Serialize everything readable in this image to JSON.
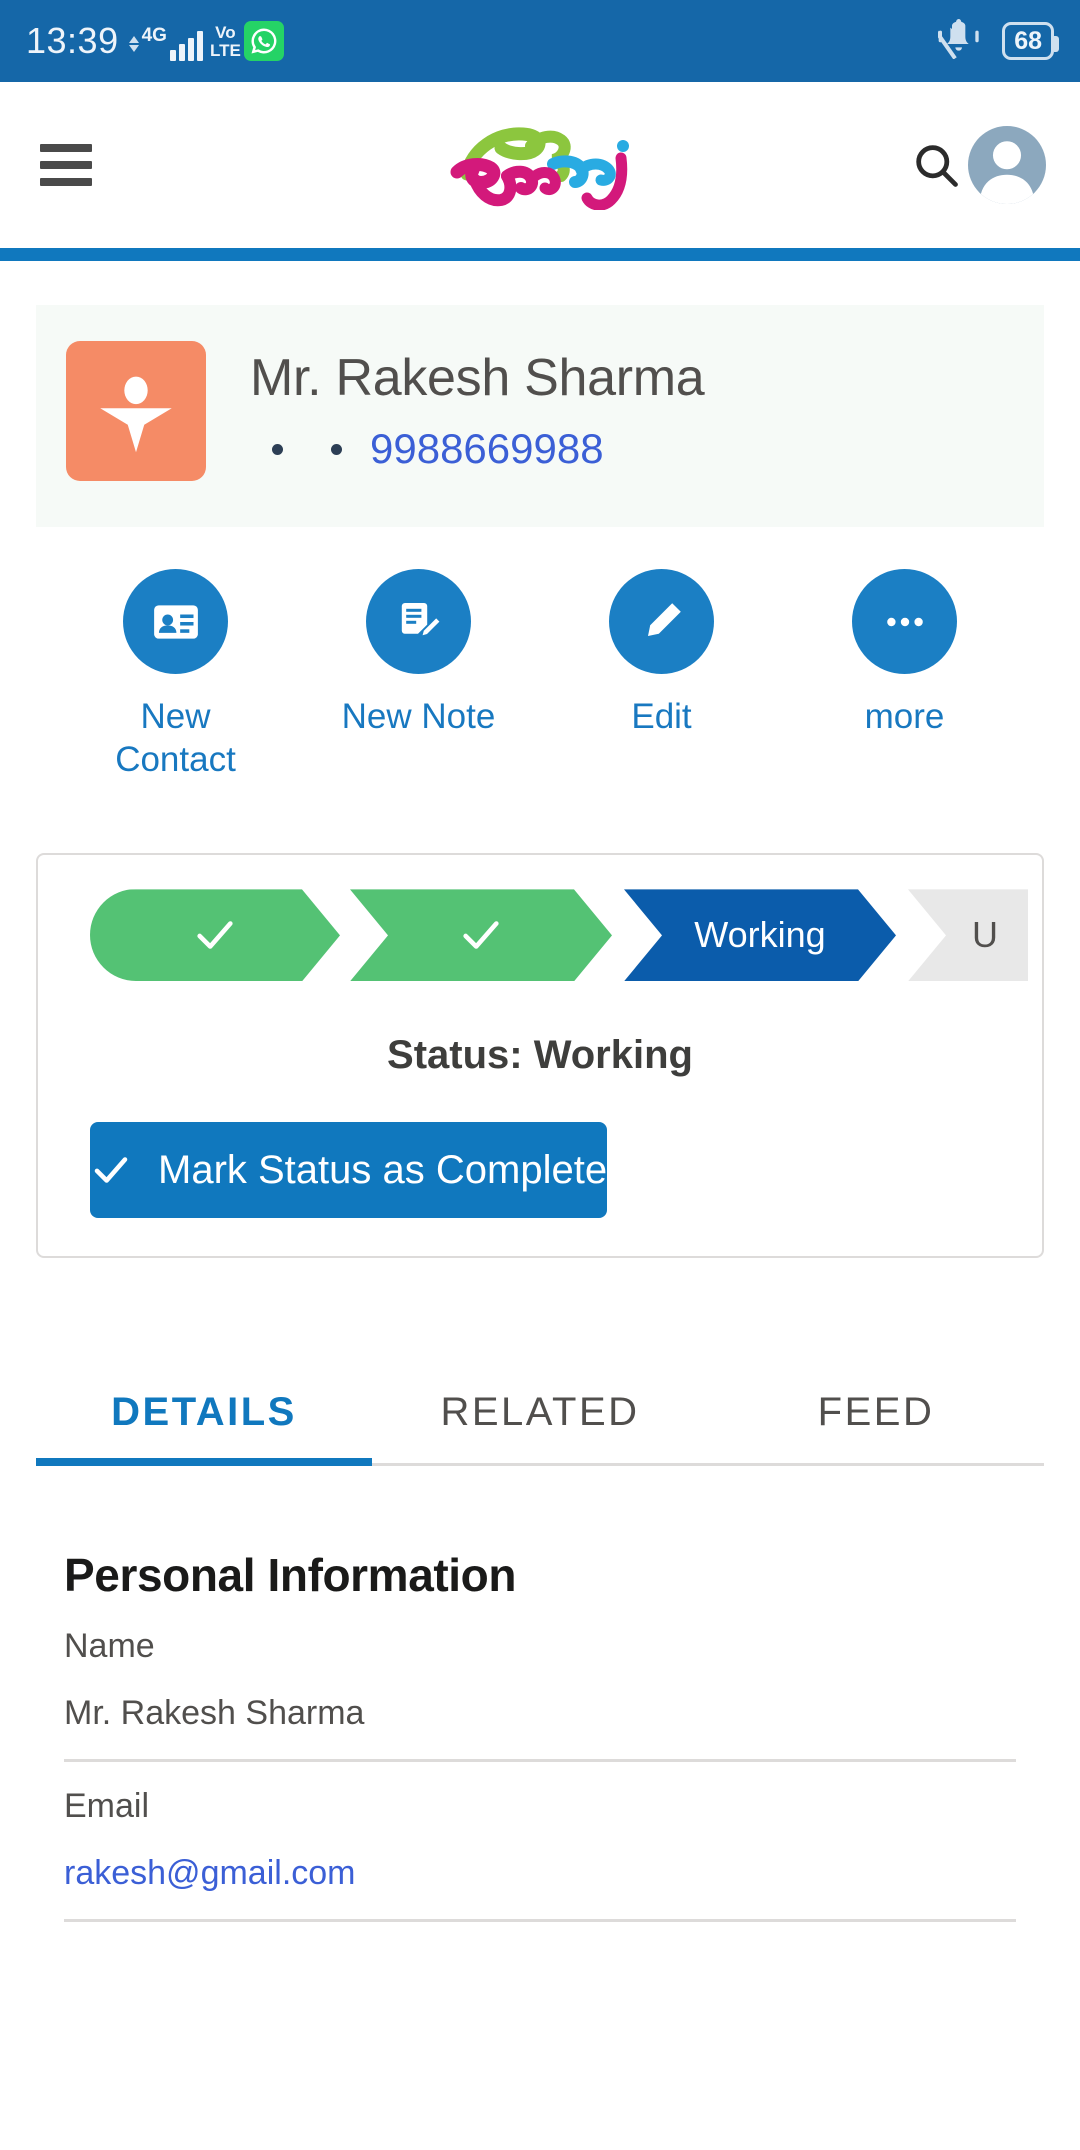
{
  "status_bar": {
    "time": "13:39",
    "network_type": "4G",
    "volte_line1": "Vo",
    "volte_line2": "LTE",
    "whatsapp_icon": "whatsapp-icon",
    "ringer_icon": "bell-muted-icon",
    "battery_percent": "68"
  },
  "app_header": {
    "menu_icon": "hamburger-menu-icon",
    "brand_name": "Godrej",
    "brand_colors": {
      "green": "#8CC63E",
      "blue": "#29ABE2",
      "magenta": "#D3197B"
    },
    "search_icon": "search-icon",
    "avatar_icon": "user-avatar-icon",
    "accent_bar_color": "#1078BE"
  },
  "record_header": {
    "object_icon": "lead-icon",
    "object_icon_color": "#F58B66",
    "title": "Mr. Rakesh Sharma",
    "subtitle_fields": [
      "",
      ""
    ],
    "phone": "9988669988",
    "phone_color": "#3B5FD6"
  },
  "quick_actions": [
    {
      "label": "New Contact",
      "icon": "contact-card-icon"
    },
    {
      "label": "New Note",
      "icon": "note-pen-icon"
    },
    {
      "label": "Edit",
      "icon": "pencil-icon"
    },
    {
      "label": "more",
      "icon": "ellipsis-icon"
    }
  ],
  "path": {
    "steps": [
      {
        "label": "",
        "state": "complete",
        "icon": "check-icon"
      },
      {
        "label": "",
        "state": "complete",
        "icon": "check-icon"
      },
      {
        "label": "Working",
        "state": "current"
      },
      {
        "label": "U",
        "state": "incomplete"
      }
    ],
    "colors": {
      "complete": "#54C274",
      "current": "#0B5CAB",
      "incomplete": "#E8E8E8"
    },
    "status_text": "Status: Working",
    "mark_complete_label": "Mark Status as Complete",
    "mark_complete_icon": "check-icon"
  },
  "tabs": [
    {
      "label": "DETAILS",
      "active": true
    },
    {
      "label": "RELATED",
      "active": false
    },
    {
      "label": "FEED",
      "active": false
    }
  ],
  "details": {
    "section_title": "Personal Information",
    "fields": [
      {
        "label": "Name",
        "value": "Mr. Rakesh Sharma",
        "is_link": false
      },
      {
        "label": "Email",
        "value": "rakesh@gmail.com",
        "is_link": true
      }
    ]
  }
}
